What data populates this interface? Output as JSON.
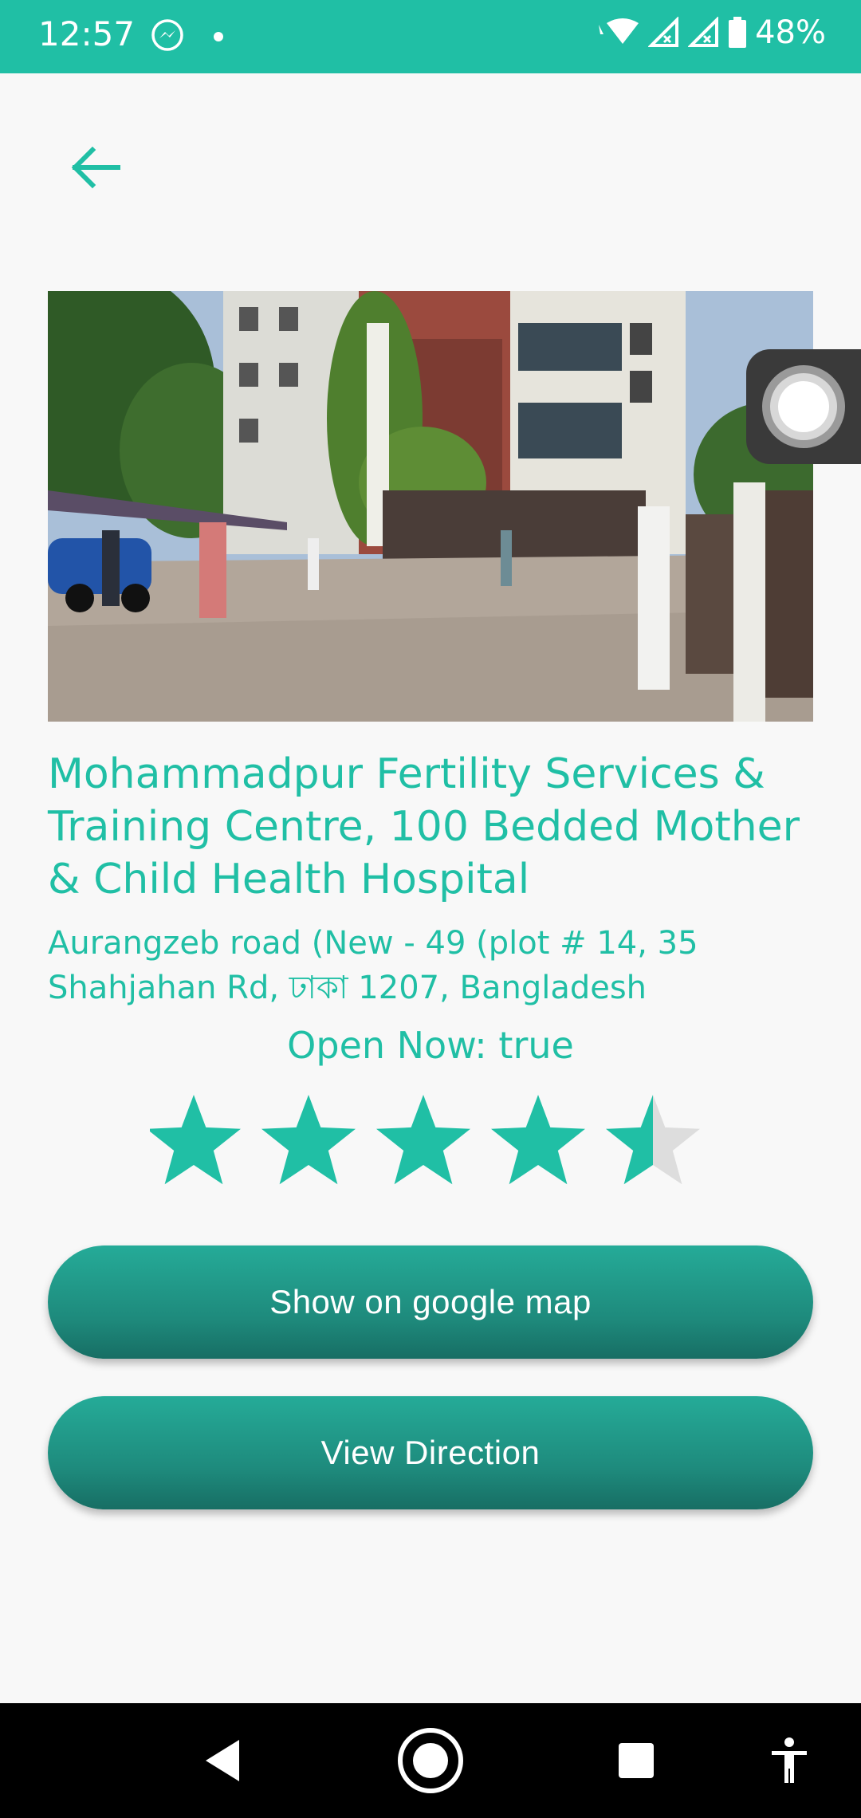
{
  "status_bar": {
    "time": "12:57",
    "battery": "48%",
    "icons": [
      "messenger-icon",
      "dot-icon",
      "wifi-icon",
      "signal-icon",
      "signal-icon",
      "battery-icon"
    ]
  },
  "header": {
    "back_icon": "arrow-left-icon"
  },
  "place": {
    "name": "Mohammadpur Fertility Services & Training Centre, 100 Bedded Mother & Child Health Hospital",
    "address": "Aurangzeb road (New - 49 (plot # 14, 35 Shahjahan Rd, ঢাকা 1207, Bangladesh",
    "open_now_label": "Open Now: ",
    "open_now_value": "true",
    "rating": 4.5,
    "rating_max": 5
  },
  "actions": {
    "map_label": "Show on google map",
    "direction_label": "View Direction"
  },
  "nav_bar": {
    "icons": [
      "back-triangle-icon",
      "home-circle-icon",
      "recents-square-icon",
      "accessibility-icon"
    ]
  },
  "colors": {
    "accent": "#20bfa5",
    "button_top": "#25ab98",
    "button_bottom": "#176e64",
    "star_empty": "#dddddd"
  }
}
